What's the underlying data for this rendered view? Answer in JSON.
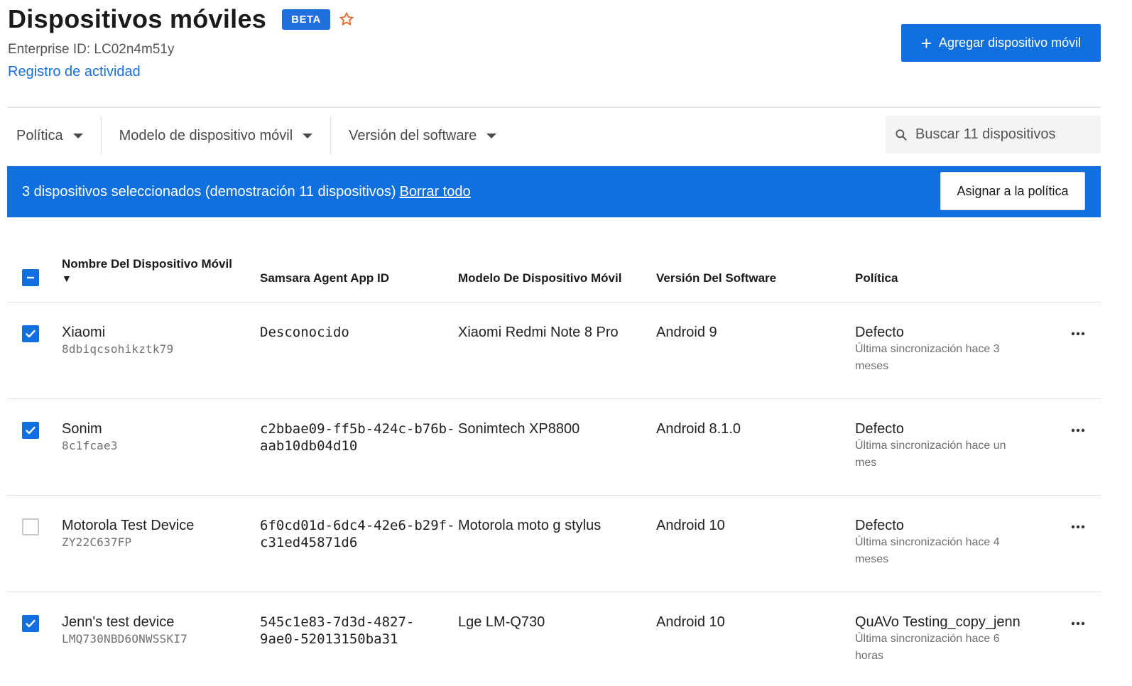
{
  "header": {
    "title": "Dispositivos móviles",
    "badge": "BETA",
    "enterprise_id": "Enterprise ID: LC02n4m51y",
    "activity_link": "Registro de actividad",
    "add_button": "Agregar dispositivo móvil"
  },
  "filters": [
    {
      "label": "Política"
    },
    {
      "label": "Modelo de dispositivo móvil"
    },
    {
      "label": "Versión del software"
    }
  ],
  "search": {
    "placeholder": "Buscar 11 dispositivos"
  },
  "banner": {
    "text": "3 dispositivos seleccionados (demostración 11 dispositivos)",
    "clear_link": "Borrar todo",
    "assign_button": "Asignar a la política"
  },
  "table": {
    "headers": {
      "name": "Nombre Del Dispositivo Móvil",
      "sort_indicator": "▼",
      "agent_id": "Samsara Agent App ID",
      "model": "Modelo De Dispositivo Móvil",
      "software": "Versión Del Software",
      "policy": "Política"
    },
    "rows": [
      {
        "name": "Xiaomi",
        "serial": "8dbiqcsohikztk79",
        "agent_id_1": "Desconocido",
        "agent_id_2": "",
        "model": "Xiaomi Redmi Note 8 Pro",
        "software": "Android 9",
        "policy": "Defecto",
        "sync_1": "Última sincronización hace 3",
        "sync_2": "meses",
        "checked": true
      },
      {
        "name": "Sonim",
        "serial": "8c1fcae3",
        "agent_id_1": "c2bbae09-ff5b-424c-b76b-",
        "agent_id_2": "aab10db04d10",
        "model": "Sonimtech XP8800",
        "software": "Android 8.1.0",
        "policy": "Defecto",
        "sync_1": "Última sincronización hace un",
        "sync_2": "mes",
        "checked": true
      },
      {
        "name": "Motorola Test Device",
        "serial": "ZY22C637FP",
        "agent_id_1": "6f0cd01d-6dc4-42e6-b29f-",
        "agent_id_2": "c31ed45871d6",
        "model": "Motorola moto g stylus",
        "software": "Android 10",
        "policy": "Defecto",
        "sync_1": "Última sincronización hace 4",
        "sync_2": "meses",
        "checked": false
      },
      {
        "name": "Jenn's test device",
        "serial": "LMQ730NBD6ONWSSKI7",
        "agent_id_1": "545c1e83-7d3d-4827-",
        "agent_id_2": "9ae0-52013150ba31",
        "model": "Lge LM-Q730",
        "software": "Android 10",
        "policy": "QuAVo Testing_copy_jenn",
        "sync_1": "Última sincronización hace 6",
        "sync_2": "horas",
        "checked": true
      }
    ]
  }
}
